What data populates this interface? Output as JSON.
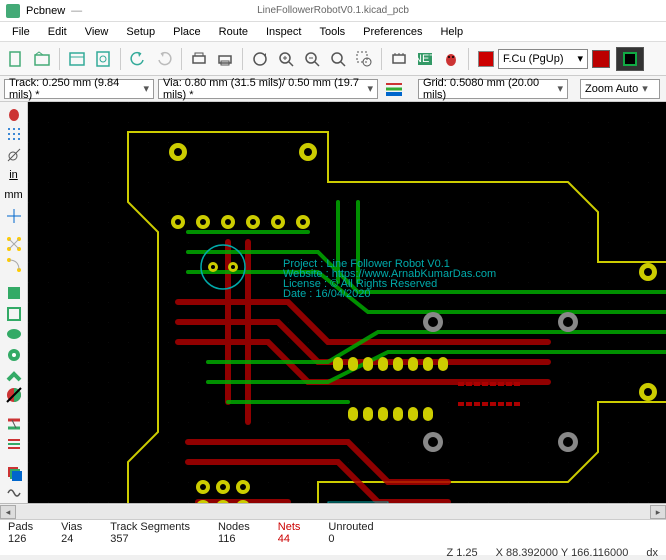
{
  "title": {
    "app": "Pcbnew",
    "dash": "—",
    "file": "LineFollowerRobotV0.1.kicad_pcb"
  },
  "menu": [
    "File",
    "Edit",
    "View",
    "Setup",
    "Place",
    "Route",
    "Inspect",
    "Tools",
    "Preferences",
    "Help"
  ],
  "layer": {
    "name": "F.Cu (PgUp)"
  },
  "opt": {
    "track": "Track: 0.250 mm (9.84 mils) *",
    "via": "Via: 0.80 mm (31.5 mils)/ 0.50 mm (19.7 mils) *",
    "grid": "Grid: 0.5080 mm (20.00 mils)",
    "zoom": "Zoom Auto"
  },
  "leftbar": {
    "in": "in",
    "mm": "mm"
  },
  "stats": {
    "pads_l": "Pads",
    "pads_v": "126",
    "vias_l": "Vias",
    "vias_v": "24",
    "ts_l": "Track Segments",
    "ts_v": "357",
    "nodes_l": "Nodes",
    "nodes_v": "116",
    "nets_l": "Nets",
    "nets_v": "44",
    "unr_l": "Unrouted",
    "unr_v": "0"
  },
  "status2": {
    "z": "Z 1.25",
    "xy": "X 88.392000  Y 166.116000",
    "d": "dx"
  },
  "silkscreen": {
    "l1": "Project : Line Follower Robot V0.1",
    "l2": "Website : https://www.ArnabKumarDas.com",
    "l3": "License : © All Rights Reserved",
    "l4": "Date : 16/04/2020"
  }
}
